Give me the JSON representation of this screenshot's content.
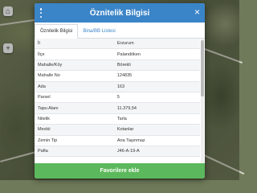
{
  "modal": {
    "title": "Öznitelik Bilgisi",
    "close_glyph": "×"
  },
  "tabs": [
    {
      "label": "Öznitelik Bilgisi",
      "active": true
    },
    {
      "label": "Bina/BB Listesi",
      "active": false
    }
  ],
  "attributes": [
    {
      "key": "İl",
      "value": "Erzurum"
    },
    {
      "key": "İlçe",
      "value": "Palandöken"
    },
    {
      "key": "Mahalle/Köy",
      "value": "Börekli"
    },
    {
      "key": "Mahalle No",
      "value": "124835"
    },
    {
      "key": "Ada",
      "value": "163"
    },
    {
      "key": "Parsel",
      "value": "5"
    },
    {
      "key": "Tapu Alanı",
      "value": "11.379,54"
    },
    {
      "key": "Nitelik",
      "value": "Tarla"
    },
    {
      "key": "Mevkii",
      "value": "Kotanlar"
    },
    {
      "key": "Zemin Tip",
      "value": "Ana Taşınmaz"
    },
    {
      "key": "Pafta",
      "value": "J46-A-19-A"
    }
  ],
  "footer": {
    "button_label": "Favorilere ekle"
  },
  "colors": {
    "header": "#3a84c8",
    "button": "#5cb85c"
  },
  "icons": {
    "menu": "kebab-menu-icon",
    "close": "close-icon"
  }
}
